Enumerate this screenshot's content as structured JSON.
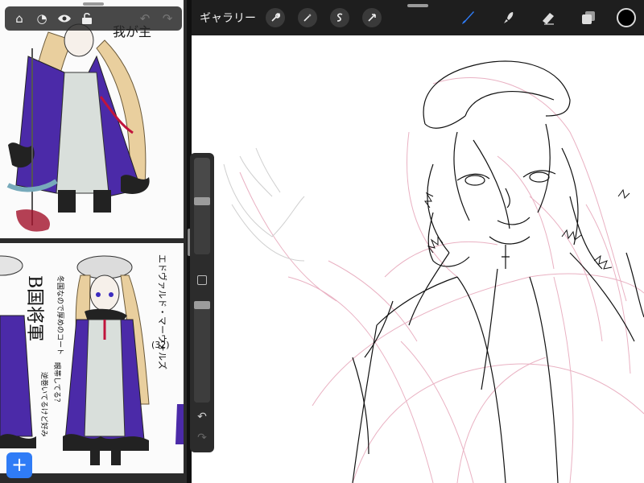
{
  "left_toolbar": {
    "home_icon": "house-icon",
    "disable_icon": "adjust-icon",
    "eye_icon": "eye-icon",
    "lock_icon": "unlock-icon",
    "undo_icon": "undo-arrow-icon",
    "redo_icon": "redo-arrow-icon"
  },
  "reference": {
    "bottom_title": "B国将軍",
    "bottom_name": "エドヴァルド・マーウォルズ",
    "bottom_age": "(32)",
    "bottom_note1": "冬国なので厚めのコート",
    "bottom_note2": "眼帯してる？",
    "bottom_note3": "逆巻いてるけど好み",
    "top_note": "我が主",
    "add_button_label": "+"
  },
  "app": {
    "gallery_label": "ギャラリー",
    "actions_icon": "wrench-icon",
    "adjustments_icon": "magic-wand-icon",
    "selection_icon": "selection-s-icon",
    "transform_icon": "arrow-cursor-icon",
    "brush_icon": "brush-icon",
    "smudge_icon": "smudge-icon",
    "eraser_icon": "eraser-icon",
    "layers_icon": "layers-icon",
    "current_color": "#000000",
    "accent_color": "#2f7cf6"
  },
  "sidebar": {
    "brush_size_level": 0.55,
    "opacity_level": 1.0,
    "undo_icon": "undo-icon",
    "redo_icon": "redo-icon"
  }
}
